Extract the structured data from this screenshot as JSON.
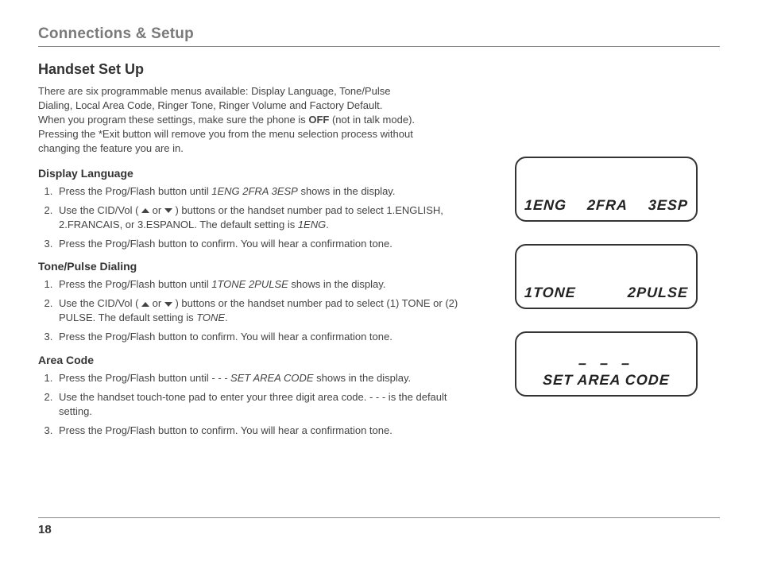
{
  "header": {
    "section_title": "Connections & Setup"
  },
  "title": "Handset Set Up",
  "intro": {
    "l1": "There are six programmable menus available: Display Language, Tone/Pulse",
    "l2": "Dialing, Local Area Code, Ringer Tone, Ringer Volume and Factory Default.",
    "l3a": "When you program these settings, make sure the phone is ",
    "l3b": "OFF",
    "l3c": " (not in talk mode).",
    "l4": "Pressing the *Exit button will remove you from the menu selection process without",
    "l5": "changing the feature you are in."
  },
  "sections": {
    "display_language": {
      "heading": "Display Language",
      "steps": [
        {
          "a": "Press the Prog/Flash button until ",
          "i": "1ENG 2FRA 3ESP",
          "b": " shows in the display."
        },
        {
          "a": "Use the CID/Vol ( ",
          "arrows": true,
          "mid": " or ",
          "b": " ) buttons or the handset number pad to select 1.ENGLISH, 2.FRANCAIS, or 3.ESPANOL. The default setting is ",
          "i": "1ENG",
          "c": "."
        },
        {
          "a": "Press the Prog/Flash button to confirm. You will hear a confirmation tone."
        }
      ]
    },
    "tone_pulse": {
      "heading": "Tone/Pulse Dialing",
      "steps": [
        {
          "a": "Press the Prog/Flash button until ",
          "i": "1TONE 2PULSE",
          "b": " shows in the display."
        },
        {
          "a": "Use the CID/Vol ( ",
          "arrows": true,
          "mid": " or ",
          "b": " ) buttons or the handset number pad to select (1) TONE or (2) PULSE. The default setting is ",
          "i": "TONE",
          "c": "."
        },
        {
          "a": "Press the Prog/Flash button to confirm. You will hear a confirmation tone."
        }
      ]
    },
    "area_code": {
      "heading": "Area Code",
      "steps": [
        {
          "a": "Press the Prog/Flash button until ",
          "i": "- - - SET AREA CODE",
          "b": " shows in the display."
        },
        {
          "a": "Use the handset touch-tone pad to enter your three digit area code. - - - is the default setting."
        },
        {
          "a": "Press the Prog/Flash button to confirm. You will hear a confirmation tone."
        }
      ]
    }
  },
  "lcd": {
    "screen1": {
      "c1": "1ENG",
      "c2": "2FRA",
      "c3": "3ESP"
    },
    "screen2": {
      "c1": "1TONE",
      "c2": "2PULSE"
    },
    "screen3": {
      "top": "– – –",
      "bottom": "SET  AREA  CODE"
    }
  },
  "footer": {
    "page": "18"
  }
}
